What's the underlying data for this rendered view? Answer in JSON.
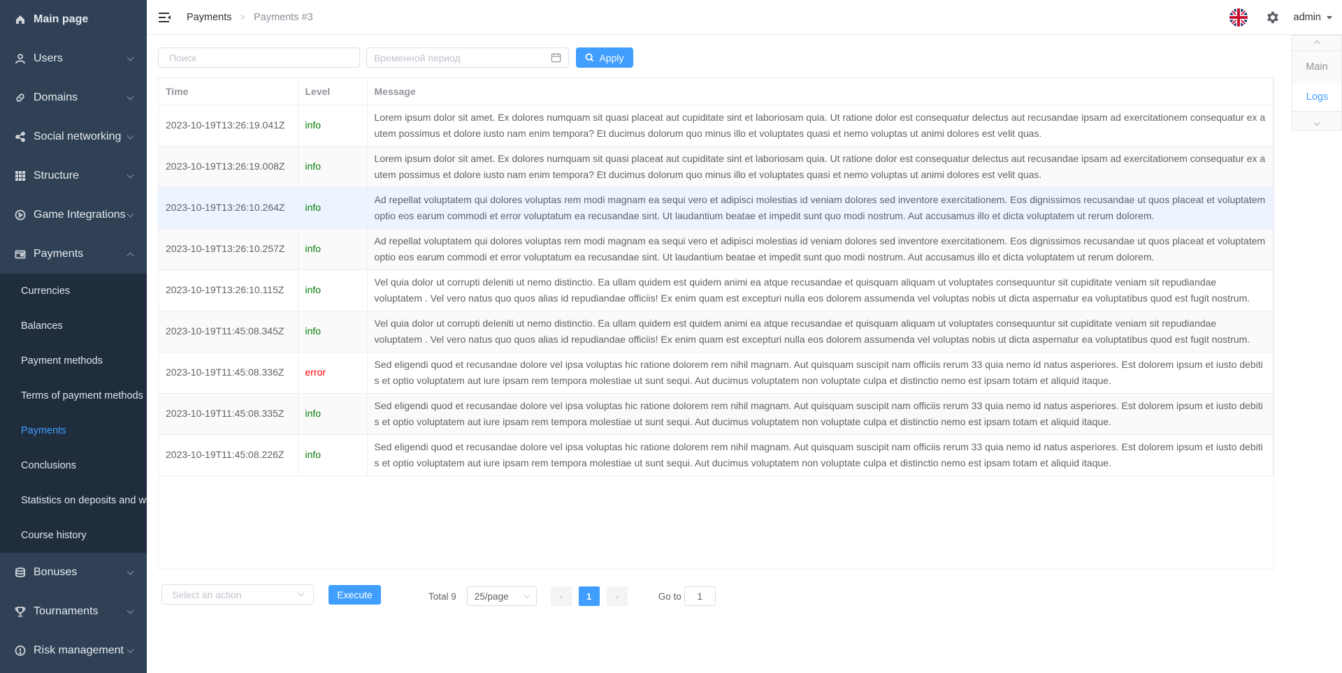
{
  "sidebar": {
    "items": [
      {
        "label": "Main page",
        "icon": "home-icon"
      },
      {
        "label": "Users",
        "icon": "user-icon"
      },
      {
        "label": "Domains",
        "icon": "link-icon"
      },
      {
        "label": "Social networking",
        "icon": "share-icon"
      },
      {
        "label": "Structure",
        "icon": "grid-icon"
      },
      {
        "label": "Game Integrations",
        "icon": "play-icon"
      },
      {
        "label": "Payments",
        "icon": "wallet-icon"
      }
    ],
    "payments_submenu": [
      "Currencies",
      "Balances",
      "Payment methods",
      "Terms of payment methods",
      "Payments",
      "Conclusions",
      "Statistics on deposits and withdrawals",
      "Course history"
    ],
    "active_submenu": "Payments",
    "bottom_items": [
      {
        "label": "Bonuses",
        "icon": "coins-icon"
      },
      {
        "label": "Tournaments",
        "icon": "trophy-icon"
      },
      {
        "label": "Risk management",
        "icon": "alert-icon"
      }
    ]
  },
  "header": {
    "breadcrumb": [
      "Payments",
      "Payments #3"
    ],
    "user": "admin",
    "language_flag": "uk-flag-icon"
  },
  "filters": {
    "search_placeholder": "Поиск",
    "period_placeholder": "Временной период",
    "apply_label": "Apply"
  },
  "table": {
    "columns": [
      "Time",
      "Level",
      "Message"
    ],
    "rows": [
      {
        "time": "2023-10-19T13:26:19.041Z",
        "level": "info",
        "message": "Lorem ipsum dolor sit amet. Ex dolores numquam sit quasi placeat aut cupiditate sint et laboriosam quia. Ut ratione dolor est consequatur delectus aut recusandae ipsam ad exercitationem consequatur ex a utem possimus et dolore iusto nam enim tempora? Et ducimus dolorum quo minus illo et voluptates quasi et nemo voluptas ut animi dolores est velit quas."
      },
      {
        "time": "2023-10-19T13:26:19.008Z",
        "level": "info",
        "message": "Lorem ipsum dolor sit amet. Ex dolores numquam sit quasi placeat aut cupiditate sint et laboriosam quia. Ut ratione dolor est consequatur delectus aut recusandae ipsam ad exercitationem consequatur ex a utem possimus et dolore iusto nam enim tempora? Et ducimus dolorum quo minus illo et voluptates quasi et nemo voluptas ut animi dolores est velit quas."
      },
      {
        "time": "2023-10-19T13:26:10.264Z",
        "level": "info",
        "message": "Ad repellat voluptatem qui dolores voluptas rem modi magnam ea sequi vero et adipisci molestias id veniam dolores sed inventore exercitationem. Eos dignissimos recusandae ut quos placeat et voluptatem optio eos earum commodi et error voluptatum ea recusandae sint. Ut laudantium beatae et impedit sunt quo modi nostrum. Aut accusamus illo et dicta voluptatem ut rerum dolorem."
      },
      {
        "time": "2023-10-19T13:26:10.257Z",
        "level": "info",
        "message": "Ad repellat voluptatem qui dolores voluptas rem modi magnam ea sequi vero et adipisci molestias id veniam dolores sed inventore exercitationem. Eos dignissimos recusandae ut quos placeat et voluptatem optio eos earum commodi et error voluptatum ea recusandae sint. Ut laudantium beatae et impedit sunt quo modi nostrum. Aut accusamus illo et dicta voluptatem ut rerum dolorem."
      },
      {
        "time": "2023-10-19T13:26:10.115Z",
        "level": "info",
        "message": "Vel quia dolor ut corrupti deleniti ut nemo distinctio. Ea ullam quidem est quidem animi ea atque recusandae et quisquam aliquam ut voluptates consequuntur sit cupiditate veniam sit repudiandae voluptatem . Vel vero natus quo quos alias id repudiandae officiis! Ex enim quam est excepturi nulla eos dolorem assumenda vel voluptas nobis ut dicta aspernatur ea voluptatibus quod est fugit nostrum."
      },
      {
        "time": "2023-10-19T11:45:08.345Z",
        "level": "info",
        "message": "Vel quia dolor ut corrupti deleniti ut nemo distinctio. Ea ullam quidem est quidem animi ea atque recusandae et quisquam aliquam ut voluptates consequuntur sit cupiditate veniam sit repudiandae voluptatem . Vel vero natus quo quos alias id repudiandae officiis! Ex enim quam est excepturi nulla eos dolorem assumenda vel voluptas nobis ut dicta aspernatur ea voluptatibus quod est fugit nostrum."
      },
      {
        "time": "2023-10-19T11:45:08.336Z",
        "level": "error",
        "message": "Sed eligendi quod et recusandae dolore vel ipsa voluptas hic ratione dolorem rem nihil magnam. Aut quisquam suscipit nam officiis rerum 33 quia nemo id natus asperiores. Est dolorem ipsum et iusto debiti s et optio voluptatem aut iure ipsam rem tempora molestiae ut sunt sequi. Aut ducimus voluptatem non voluptate culpa et distinctio nemo est ipsam totam et aliquid itaque."
      },
      {
        "time": "2023-10-19T11:45:08.335Z",
        "level": "info",
        "message": "Sed eligendi quod et recusandae dolore vel ipsa voluptas hic ratione dolorem rem nihil magnam. Aut quisquam suscipit nam officiis rerum 33 quia nemo id natus asperiores. Est dolorem ipsum et iusto debiti s et optio voluptatem aut iure ipsam rem tempora molestiae ut sunt sequi. Aut ducimus voluptatem non voluptate culpa et distinctio nemo est ipsam totam et aliquid itaque."
      },
      {
        "time": "2023-10-19T11:45:08.226Z",
        "level": "info",
        "message": "Sed eligendi quod et recusandae dolore vel ipsa voluptas hic ratione dolorem rem nihil magnam. Aut quisquam suscipit nam officiis rerum 33 quia nemo id natus asperiores. Est dolorem ipsum et iusto debiti s et optio voluptatem aut iure ipsam rem tempora molestiae ut sunt sequi. Aut ducimus voluptatem non voluptate culpa et distinctio nemo est ipsam totam et aliquid itaque."
      }
    ]
  },
  "actions": {
    "select_placeholder": "Select an action",
    "execute_label": "Execute"
  },
  "pagination": {
    "total_label": "Total 9",
    "page_size": "25/page",
    "current_page": "1",
    "goto_label": "Go to",
    "goto_value": "1",
    "prev_icon": "‹",
    "next_icon": "›"
  },
  "right_panel": {
    "tabs": [
      "Main",
      "Logs"
    ],
    "active": "Logs"
  },
  "colors": {
    "sidebar_bg": "#304156",
    "submenu_bg": "#1f2d3d",
    "accent": "#409eff",
    "info": "#067d06",
    "error": "#ff0000"
  }
}
